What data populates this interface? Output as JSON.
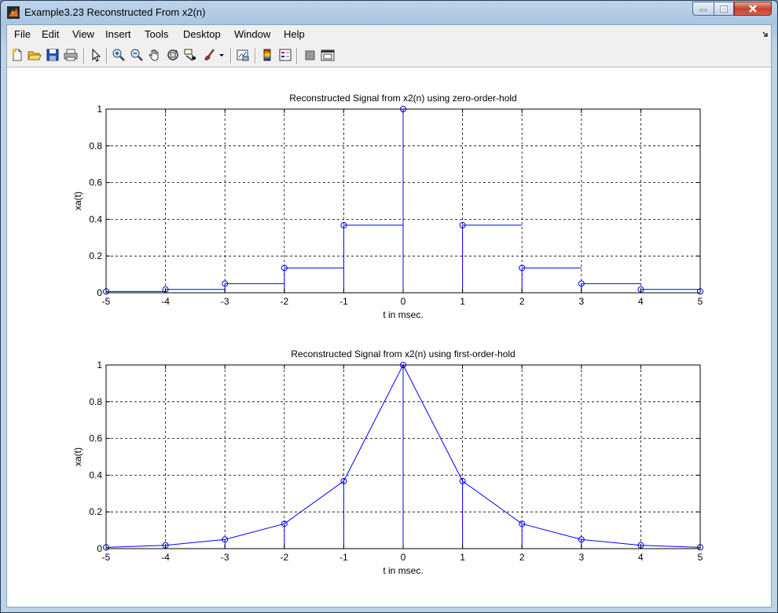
{
  "window": {
    "title": "Example3.23 Reconstructed From x2(n)",
    "buttons": [
      "minimize",
      "maximize",
      "close"
    ]
  },
  "menubar": {
    "items": [
      "File",
      "Edit",
      "View",
      "Insert",
      "Tools",
      "Desktop",
      "Window",
      "Help"
    ]
  },
  "toolbar": {
    "icons": [
      "new-figure-icon",
      "open-file-icon",
      "save-icon",
      "print-icon",
      "edit-plot-arrow-icon",
      "zoom-in-icon",
      "zoom-out-icon",
      "pan-hand-icon",
      "rotate-3d-icon",
      "data-cursor-icon",
      "brush-icon",
      "brush-dropdown-icon",
      "link-plot-icon",
      "insert-colorbar-icon",
      "insert-legend-icon",
      "hide-plot-tools-icon",
      "show-plot-tools-icon"
    ]
  },
  "colors": {
    "line": "#0000ff",
    "grid": "#000000",
    "background": "#ffffff"
  },
  "chart_data": [
    {
      "type": "line",
      "style": "zero-order-hold stairs with stem markers",
      "title": "Reconstructed Signal from x2(n) using zero-order-hold",
      "xlabel": "t in msec.",
      "ylabel": "xa(t)",
      "xlim": [
        -5,
        5
      ],
      "ylim": [
        0,
        1
      ],
      "xticks": [
        "-5",
        "-4",
        "-3",
        "-2",
        "-1",
        "0",
        "1",
        "2",
        "3",
        "4",
        "5"
      ],
      "yticks": [
        "0",
        "0.2",
        "0.4",
        "0.6",
        "0.8",
        "1"
      ],
      "grid": true,
      "series": [
        {
          "x": [
            -5,
            -4,
            -3,
            -2,
            -1,
            0,
            1,
            2,
            3,
            4,
            5
          ],
          "y": [
            0.0067,
            0.0183,
            0.0498,
            0.1353,
            0.3679,
            1.0,
            0.3679,
            0.1353,
            0.0498,
            0.0183,
            0.0067
          ]
        }
      ]
    },
    {
      "type": "line",
      "style": "first-order-hold linear interpolation with stem markers",
      "title": "Reconstructed Signal from x2(n) using first-order-hold",
      "xlabel": "t in msec.",
      "ylabel": "xa(t)",
      "xlim": [
        -5,
        5
      ],
      "ylim": [
        0,
        1
      ],
      "xticks": [
        "-5",
        "-4",
        "-3",
        "-2",
        "-1",
        "0",
        "1",
        "2",
        "3",
        "4",
        "5"
      ],
      "yticks": [
        "0",
        "0.2",
        "0.4",
        "0.6",
        "0.8",
        "1"
      ],
      "grid": true,
      "series": [
        {
          "x": [
            -5,
            -4,
            -3,
            -2,
            -1,
            0,
            1,
            2,
            3,
            4,
            5
          ],
          "y": [
            0.0067,
            0.0183,
            0.0498,
            0.1353,
            0.3679,
            1.0,
            0.3679,
            0.1353,
            0.0498,
            0.0183,
            0.0067
          ]
        }
      ]
    }
  ]
}
